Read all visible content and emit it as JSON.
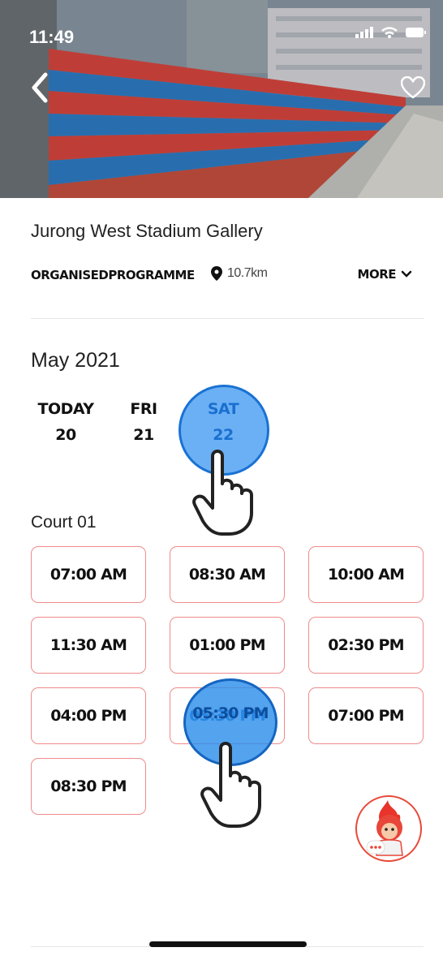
{
  "status_bar": {
    "time": "11:49"
  },
  "venue": {
    "name": "Jurong West Stadium Gallery",
    "type": "ORGANISEDPROGRAMME",
    "distance": "10.7km",
    "more_label": "MORE"
  },
  "calendar": {
    "month": "May 2021",
    "days": [
      {
        "label": "TODAY",
        "date": "20"
      },
      {
        "label": "FRI",
        "date": "21"
      },
      {
        "label": "SAT",
        "date": "22"
      }
    ],
    "selected_index": 2
  },
  "court": {
    "name": "Court 01",
    "slots": [
      "07:00 AM",
      "08:30 AM",
      "10:00 AM",
      "11:30 AM",
      "01:00 PM",
      "02:30 PM",
      "04:00 PM",
      "05:30 PM",
      "07:00 PM",
      "08:30 PM"
    ],
    "selected_slot": "05:30 PM"
  },
  "colors": {
    "accent_red": "#f08b8b",
    "selection_blue": "#3a96f0"
  },
  "icons": [
    "back-chevron-icon",
    "heart-icon",
    "location-pin-icon",
    "chevron-down-icon",
    "tap-hand-icon",
    "mascot-chat-icon"
  ]
}
